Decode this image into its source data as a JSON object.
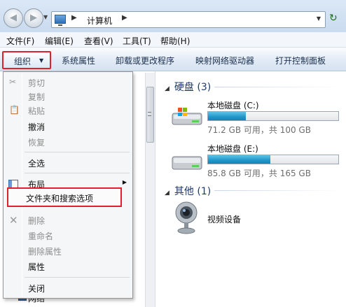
{
  "address": {
    "crumb": "计算机"
  },
  "menu_bar": {
    "items": [
      "文件(F)",
      "编辑(E)",
      "查看(V)",
      "工具(T)",
      "帮助(H)"
    ]
  },
  "command_bar": {
    "organize": "组织",
    "buttons": [
      "系统属性",
      "卸载或更改程序",
      "映射网络驱动器",
      "打开控制面板"
    ]
  },
  "dropdown": {
    "items": [
      "剪切",
      "复制",
      "粘贴",
      "撤消",
      "恢复",
      "全选",
      "布局",
      "文件夹和搜索选项",
      "删除",
      "重命名",
      "删除属性",
      "属性",
      "关闭"
    ],
    "highlighted": "文件夹和搜索选项"
  },
  "content": {
    "hard_drives": {
      "header": "硬盘 (3)",
      "drives": [
        {
          "name": "本地磁盘 (C:)",
          "info": "71.2 GB 可用，共 100 GB",
          "used_fraction": 0.29
        },
        {
          "name": "本地磁盘 (E:)",
          "info": "85.8 GB 可用，共 165 GB",
          "used_fraction": 0.48
        }
      ]
    },
    "other": {
      "header": "其他 (1)",
      "device": "视频设备"
    }
  },
  "nav_pane": {
    "bottom_item": "网络"
  },
  "colors": {
    "highlight_red": "#e0212b",
    "drive_fill": "#2196c9",
    "header_blue": "#1e3a6e"
  }
}
